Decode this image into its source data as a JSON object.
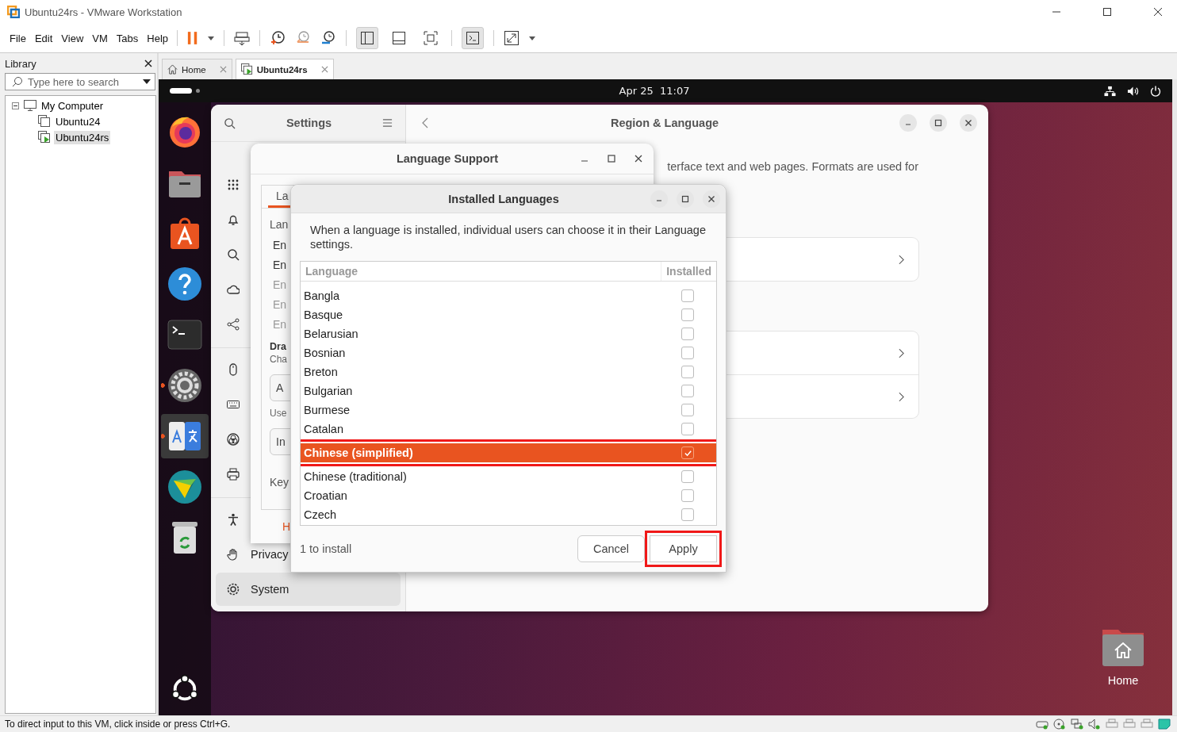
{
  "window": {
    "title": "Ubuntu24rs - VMware Workstation"
  },
  "menu": [
    "File",
    "Edit",
    "View",
    "VM",
    "Tabs",
    "Help"
  ],
  "library": {
    "title": "Library",
    "search": {
      "placeholder": "Type here to search"
    },
    "tree": [
      {
        "label": "My Computer",
        "expanded": true,
        "children": [
          {
            "label": "Ubuntu24",
            "selected": false,
            "running": false
          },
          {
            "label": "Ubuntu24rs",
            "selected": true,
            "running": true
          }
        ]
      }
    ]
  },
  "tabs": [
    {
      "label": "Home",
      "kind": "home",
      "selected": false
    },
    {
      "label": "Ubuntu24rs",
      "kind": "vm",
      "selected": true
    }
  ],
  "top_bar": {
    "clock": "Apr 25  11:07"
  },
  "dock": [
    {
      "kind": "browser",
      "running": false,
      "selected": false
    },
    {
      "kind": "files",
      "running": false,
      "selected": false
    },
    {
      "kind": "store",
      "running": false,
      "selected": false
    },
    {
      "kind": "help",
      "running": false,
      "selected": false
    },
    {
      "kind": "terminal",
      "running": false,
      "selected": false
    },
    {
      "kind": "settings",
      "running": true,
      "selected": false
    },
    {
      "kind": "language",
      "running": true,
      "selected": true
    },
    {
      "kind": "diamond",
      "running": false,
      "selected": false
    },
    {
      "kind": "trash",
      "running": false,
      "selected": false
    }
  ],
  "settings": {
    "title": "Settings",
    "sidebar_groups": [
      {
        "items": [
          {
            "kind": "apps",
            "selected": false
          },
          {
            "kind": "notifications",
            "selected": false
          },
          {
            "kind": "search",
            "selected": false
          },
          {
            "kind": "cloud",
            "selected": false
          },
          {
            "kind": "sharing",
            "selected": false
          }
        ]
      },
      {
        "items": [
          {
            "kind": "mouse",
            "selected": false
          },
          {
            "kind": "keyboard",
            "selected": false
          },
          {
            "kind": "color",
            "selected": false
          },
          {
            "kind": "printer",
            "selected": false
          }
        ]
      },
      {
        "items": [
          {
            "kind": "accessibility",
            "selected": false
          },
          {
            "kind": "privacy",
            "label": "Privacy",
            "selected": false
          },
          {
            "kind": "system",
            "label": "System",
            "selected": true
          }
        ]
      }
    ],
    "panel": {
      "title": "Region & Language",
      "description": "terface text and web pages. Formats are used for"
    }
  },
  "language_support": {
    "title": "Language Support",
    "tab": "La",
    "section": "Lan",
    "languages": [
      {
        "label": "En",
        "dimmed": false
      },
      {
        "label": "En",
        "dimmed": false
      },
      {
        "label": "En",
        "dimmed": true
      },
      {
        "label": "En",
        "dimmed": true
      },
      {
        "label": "En",
        "dimmed": true
      }
    ],
    "drag_title": "Dra",
    "drag_hint": "Cha",
    "button_1": "A",
    "hint": "Use",
    "button_2": "In",
    "keyboard": "Key",
    "help_link": "H"
  },
  "installed_languages": {
    "title": "Installed Languages",
    "description": "When a language is installed, individual users can choose it in their Language settings.",
    "columns": [
      "Language",
      "Installed"
    ],
    "rows": [
      {
        "name": "Bangla",
        "installed": false,
        "selected": false,
        "highlighted": false
      },
      {
        "name": "Basque",
        "installed": false,
        "selected": false,
        "highlighted": false
      },
      {
        "name": "Belarusian",
        "installed": false,
        "selected": false,
        "highlighted": false
      },
      {
        "name": "Bosnian",
        "installed": false,
        "selected": false,
        "highlighted": false
      },
      {
        "name": "Breton",
        "installed": false,
        "selected": false,
        "highlighted": false
      },
      {
        "name": "Bulgarian",
        "installed": false,
        "selected": false,
        "highlighted": false
      },
      {
        "name": "Burmese",
        "installed": false,
        "selected": false,
        "highlighted": false
      },
      {
        "name": "Catalan",
        "installed": false,
        "selected": false,
        "highlighted": false
      },
      {
        "name": "Chinese (simplified)",
        "installed": true,
        "selected": true,
        "highlighted": true
      },
      {
        "name": "Chinese (traditional)",
        "installed": false,
        "selected": false,
        "highlighted": false
      },
      {
        "name": "Croatian",
        "installed": false,
        "selected": false,
        "highlighted": false
      },
      {
        "name": "Czech",
        "installed": false,
        "selected": false,
        "highlighted": false
      }
    ],
    "status": "1 to install",
    "buttons": [
      {
        "label": "Cancel",
        "highlighted": false
      },
      {
        "label": "Apply",
        "highlighted": true
      }
    ]
  },
  "desktop": {
    "icons": [
      {
        "label": "Home"
      }
    ]
  },
  "status_bar": {
    "text": "To direct input to this VM, click inside or press Ctrl+G."
  }
}
